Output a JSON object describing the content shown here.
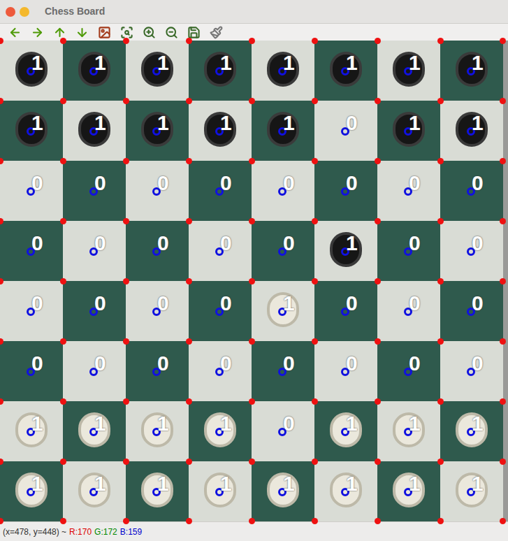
{
  "window": {
    "title": "Chess Board"
  },
  "board": {
    "rows": [
      [
        {
          "label": "1",
          "kind": "black"
        },
        {
          "label": "1",
          "kind": "black"
        },
        {
          "label": "1",
          "kind": "black"
        },
        {
          "label": "1",
          "kind": "black"
        },
        {
          "label": "1",
          "kind": "black"
        },
        {
          "label": "1",
          "kind": "black"
        },
        {
          "label": "1",
          "kind": "black"
        },
        {
          "label": "1",
          "kind": "black"
        }
      ],
      [
        {
          "label": "1",
          "kind": "black"
        },
        {
          "label": "1",
          "kind": "black"
        },
        {
          "label": "1",
          "kind": "black"
        },
        {
          "label": "1",
          "kind": "black"
        },
        {
          "label": "1",
          "kind": "black"
        },
        {
          "label": "0",
          "kind": "empty"
        },
        {
          "label": "1",
          "kind": "black"
        },
        {
          "label": "1",
          "kind": "black"
        }
      ],
      [
        {
          "label": "0",
          "kind": "empty"
        },
        {
          "label": "0",
          "kind": "empty"
        },
        {
          "label": "0",
          "kind": "empty"
        },
        {
          "label": "0",
          "kind": "empty"
        },
        {
          "label": "0",
          "kind": "empty"
        },
        {
          "label": "0",
          "kind": "empty"
        },
        {
          "label": "0",
          "kind": "empty"
        },
        {
          "label": "0",
          "kind": "empty"
        }
      ],
      [
        {
          "label": "0",
          "kind": "empty"
        },
        {
          "label": "0",
          "kind": "empty"
        },
        {
          "label": "0",
          "kind": "empty"
        },
        {
          "label": "0",
          "kind": "empty"
        },
        {
          "label": "0",
          "kind": "empty"
        },
        {
          "label": "1",
          "kind": "black"
        },
        {
          "label": "0",
          "kind": "empty"
        },
        {
          "label": "0",
          "kind": "empty"
        }
      ],
      [
        {
          "label": "0",
          "kind": "empty"
        },
        {
          "label": "0",
          "kind": "empty"
        },
        {
          "label": "0",
          "kind": "empty"
        },
        {
          "label": "0",
          "kind": "empty"
        },
        {
          "label": "1",
          "kind": "white"
        },
        {
          "label": "0",
          "kind": "empty"
        },
        {
          "label": "0",
          "kind": "empty"
        },
        {
          "label": "0",
          "kind": "empty"
        }
      ],
      [
        {
          "label": "0",
          "kind": "empty"
        },
        {
          "label": "0",
          "kind": "empty"
        },
        {
          "label": "0",
          "kind": "empty"
        },
        {
          "label": "0",
          "kind": "empty"
        },
        {
          "label": "0",
          "kind": "empty"
        },
        {
          "label": "0",
          "kind": "empty"
        },
        {
          "label": "0",
          "kind": "empty"
        },
        {
          "label": "0",
          "kind": "empty"
        }
      ],
      [
        {
          "label": "1",
          "kind": "white"
        },
        {
          "label": "1",
          "kind": "white"
        },
        {
          "label": "1",
          "kind": "white"
        },
        {
          "label": "1",
          "kind": "white"
        },
        {
          "label": "0",
          "kind": "empty"
        },
        {
          "label": "1",
          "kind": "white"
        },
        {
          "label": "1",
          "kind": "white"
        },
        {
          "label": "1",
          "kind": "white"
        }
      ],
      [
        {
          "label": "1",
          "kind": "white"
        },
        {
          "label": "1",
          "kind": "white"
        },
        {
          "label": "1",
          "kind": "white"
        },
        {
          "label": "1",
          "kind": "white"
        },
        {
          "label": "1",
          "kind": "white"
        },
        {
          "label": "1",
          "kind": "white"
        },
        {
          "label": "1",
          "kind": "white"
        },
        {
          "label": "1",
          "kind": "white"
        }
      ]
    ]
  },
  "status_bar": {
    "position": "(x=478, y=448) ~",
    "r": "R:170",
    "g": "G:172",
    "b": "B:159"
  }
}
